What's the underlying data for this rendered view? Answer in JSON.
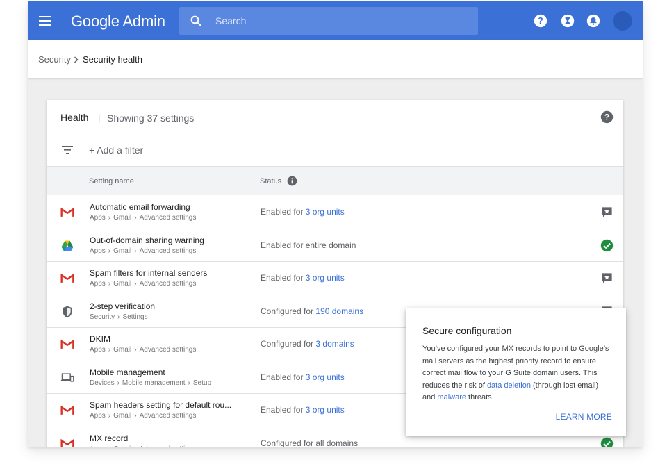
{
  "app": {
    "title": "Google Admin"
  },
  "search": {
    "placeholder": "Search"
  },
  "breadcrumb": {
    "parent": "Security",
    "current": "Security health"
  },
  "card": {
    "title": "Health",
    "divider": "|",
    "count_label": "Showing 37 settings",
    "add_filter": "+ Add a filter",
    "col_setting_name": "Setting name",
    "col_status": "Status"
  },
  "rows": [
    {
      "title": "Automatic email forwarding",
      "path": [
        "Apps",
        "Gmail",
        "Advanced settings"
      ],
      "status_prefix": "Enabled for ",
      "status_link": "3 org units",
      "icon": "gmail-icon",
      "action": "feedback-icon"
    },
    {
      "title": "Out-of-domain sharing warning",
      "path": [
        "Apps",
        "Gmail",
        "Advanced settings"
      ],
      "status_prefix": "Enabled for entire domain",
      "status_link": "",
      "icon": "drive-icon",
      "action": "check-circle-icon"
    },
    {
      "title": "Spam filters for internal senders",
      "path": [
        "Apps",
        "Gmail",
        "Advanced settings"
      ],
      "status_prefix": "Enabled for ",
      "status_link": "3 org units",
      "icon": "gmail-icon",
      "action": "feedback-icon"
    },
    {
      "title": "2-step verification",
      "path": [
        "Security",
        "Settings"
      ],
      "status_prefix": "Configured for ",
      "status_link": "190 domains",
      "icon": "shield-icon",
      "action": "feedback-icon"
    },
    {
      "title": "DKIM",
      "path": [
        "Apps",
        "Gmail",
        "Advanced settings"
      ],
      "status_prefix": "Configured for ",
      "status_link": "3 domains",
      "icon": "gmail-icon",
      "action": "feedback-icon"
    },
    {
      "title": "Mobile management",
      "path": [
        "Devices",
        "Mobile management",
        "Setup"
      ],
      "status_prefix": "Enabled for ",
      "status_link": "3 org units",
      "icon": "devices-icon",
      "action": "feedback-icon"
    },
    {
      "title": "Spam headers setting for default rou...",
      "path": [
        "Apps",
        "Gmail",
        "Advanced settings"
      ],
      "status_prefix": "Enabled for ",
      "status_link": "3 org units",
      "icon": "gmail-icon",
      "action": "feedback-icon"
    },
    {
      "title": "MX record",
      "path": [
        "Apps",
        "Gmail",
        "Advanced settings"
      ],
      "status_prefix": "Configured for all domains",
      "status_link": "",
      "icon": "gmail-icon",
      "action": "check-circle-icon"
    }
  ],
  "tooltip": {
    "title": "Secure configuration",
    "body_1": "You’ve configured your MX records to point to Google’s mail servers as the highest priority record to ensure correct mail flow to your G Suite domain users. This reduces the risk of ",
    "link_1": "data deletion",
    "body_2": " (through lost email) and ",
    "link_2": "malware",
    "body_3": " threats.",
    "learn_more": "LEARN MORE"
  },
  "colors": {
    "topbar": "#3b70d6",
    "link": "#3b70d6",
    "success": "#1e8e3e",
    "gmail_red": "#d93025"
  }
}
